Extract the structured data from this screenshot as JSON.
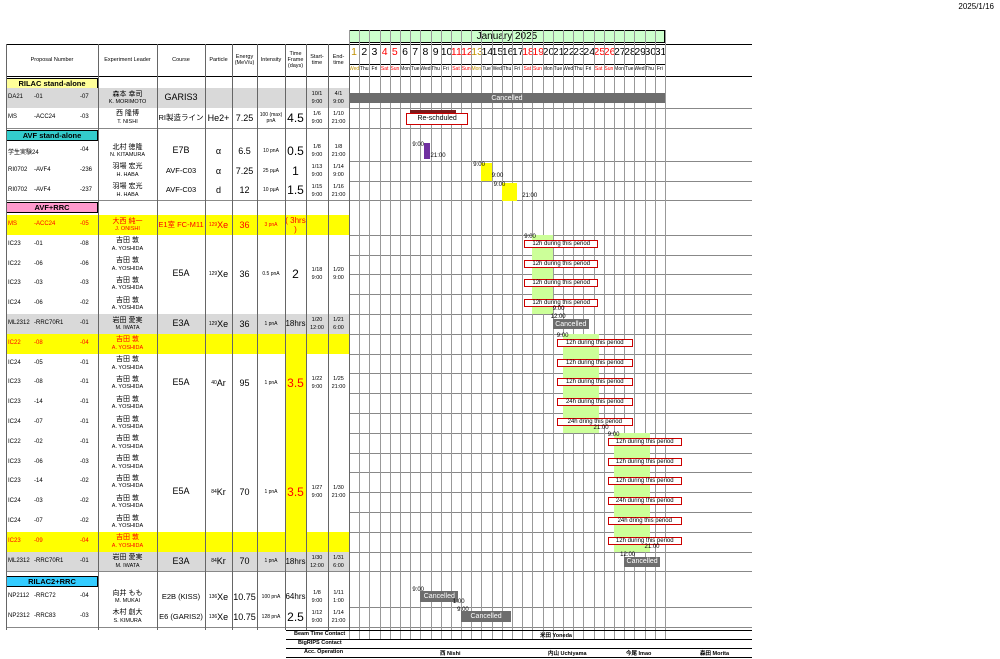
{
  "date_stamp": "2025/1/16",
  "headers": {
    "proposal": "Proposal Number",
    "leader": "Experiment Leader",
    "course": "Course",
    "particle": "Particle",
    "energy": "Energy (MeV/u)",
    "intensity": "Intensity",
    "timeframe": "Time Frame (days)",
    "start": "Start-time",
    "end": "End-time"
  },
  "month_title": "January 2025",
  "days": [
    [
      "1",
      "Wed"
    ],
    [
      "2",
      "Thu"
    ],
    [
      "3",
      "Fri"
    ],
    [
      "4",
      "Sat"
    ],
    [
      "5",
      "Sun"
    ],
    [
      "6",
      "Mon"
    ],
    [
      "7",
      "Tue"
    ],
    [
      "8",
      "Wed"
    ],
    [
      "9",
      "Thu"
    ],
    [
      "10",
      "Fri"
    ],
    [
      "11",
      "Sat"
    ],
    [
      "12",
      "Sun"
    ],
    [
      "13",
      "Mon"
    ],
    [
      "14",
      "Tue"
    ],
    [
      "15",
      "Wed"
    ],
    [
      "16",
      "Thu"
    ],
    [
      "17",
      "Fri"
    ],
    [
      "18",
      "Sat"
    ],
    [
      "19",
      "Sun"
    ],
    [
      "20",
      "Mon"
    ],
    [
      "21",
      "Tue"
    ],
    [
      "22",
      "Wed"
    ],
    [
      "23",
      "Thu"
    ],
    [
      "24",
      "Fri"
    ],
    [
      "25",
      "Sat"
    ],
    [
      "26",
      "Sun"
    ],
    [
      "27",
      "Mon"
    ],
    [
      "28",
      "Tue"
    ],
    [
      "29",
      "Wed"
    ],
    [
      "30",
      "Thu"
    ],
    [
      "31",
      "Fri"
    ]
  ],
  "colors": {
    "rilac": "#ffff99",
    "avf": "#33cccc",
    "avfrrc": "#ff99cc",
    "rilac2": "#33ccff",
    "yellow": "#ffff00",
    "red": "#ff0000",
    "grey": "#d9d9d9",
    "green": "#ccff99",
    "purple": "#7030a0",
    "holiday": "#c09000"
  },
  "sections": {
    "rilac": "RILAC stand-alone",
    "avf": "AVF stand-alone",
    "avfrrc": "AVF+RRC",
    "rilac2": "RILAC2+RRC"
  },
  "rows": [
    {
      "p1": "DA21",
      "p2": "-01",
      "p3": "-07",
      "l1": "森本 幸司",
      "l2": "K. MORIMOTO",
      "course": "GARIS3",
      "start1": "10/1",
      "start2": "9:00",
      "end1": "4/1",
      "end2": "9:00"
    },
    {
      "p1": "MS",
      "p2": "-ACC24",
      "p3": "-03",
      "l1": "西 隆博",
      "l2": "T. NISHI",
      "course": "RI製造ライン",
      "particle": "He2+",
      "energy": "7.25",
      "intensity": "100 (max) pnA",
      "tf": "4.5",
      "start1": "1/6",
      "start2": "9:00",
      "end1": "1/10",
      "end2": "21:00"
    },
    {
      "p1": "学生実験24",
      "p2": "",
      "p3": "-04",
      "l1": "北村 徳隆",
      "l2": "N. KITAMURA",
      "course": "E7B",
      "particle": "α",
      "energy": "6.5",
      "intensity": "10 pnA",
      "tf": "0.5",
      "start1": "1/8",
      "start2": "9:00",
      "end1": "1/8",
      "end2": "21:00"
    },
    {
      "p1": "RI0702",
      "p2": "-AVF4",
      "p3": "-236",
      "l1": "羽場 宏光",
      "l2": "H. HABA",
      "course": "AVF-C03",
      "particle": "α",
      "energy": "7.25",
      "intensity": "25 pμA",
      "tf": "1",
      "start1": "1/13",
      "start2": "9:00",
      "end1": "1/14",
      "end2": "9:00"
    },
    {
      "p1": "RI0702",
      "p2": "-AVF4",
      "p3": "-237",
      "l1": "羽場 宏光",
      "l2": "H. HABA",
      "course": "AVF-C03",
      "particle": "d",
      "energy": "12",
      "intensity": "10 pμA",
      "tf": "1.5",
      "start1": "1/15",
      "start2": "9:00",
      "end1": "1/16",
      "end2": "21:00"
    },
    {
      "p1": "MS",
      "p2": "-ACC24",
      "p3": "-05",
      "l1": "大西 純一",
      "l2": "J. ONISHI",
      "course": "E1室 FC-M11",
      "particle": "129Xe",
      "energy": "36",
      "intensity": "3 pnA",
      "tf": "( 3hrs )"
    },
    {
      "p1": "IC23",
      "p2": "-01",
      "p3": "-08",
      "l1": "吉田 敦",
      "l2": "A. YOSHIDA"
    },
    {
      "p1": "IC22",
      "p2": "-06",
      "p3": "-06",
      "l1": "吉田 敦",
      "l2": "A. YOSHIDA",
      "course": "E5A",
      "particle": "129Xe",
      "energy": "36",
      "intensity": "0.5 pnA",
      "tf": "2",
      "start1": "1/18",
      "start2": "9:00",
      "end1": "1/20",
      "end2": "9:00"
    },
    {
      "p1": "IC23",
      "p2": "-03",
      "p3": "-03",
      "l1": "吉田 敦",
      "l2": "A. YOSHIDA"
    },
    {
      "p1": "IC24",
      "p2": "-06",
      "p3": "-02",
      "l1": "吉田 敦",
      "l2": "A. YOSHIDA"
    },
    {
      "p1": "ML2312",
      "p2": "-RRC70R1",
      "p3": "-01",
      "l1": "岩田 愛実",
      "l2": "M. IWATA",
      "course": "E3A",
      "particle": "129Xe",
      "energy": "36",
      "intensity": "1 pnA",
      "tf": "18hrs",
      "start1": "1/20",
      "start2": "12:00",
      "end1": "1/21",
      "end2": "6:00"
    },
    {
      "p1": "IC22",
      "p2": "-08",
      "p3": "-04",
      "l1": "吉田 敦",
      "l2": "A. YOSHIDA"
    },
    {
      "p1": "IC24",
      "p2": "-05",
      "p3": "-01",
      "l1": "吉田 敦",
      "l2": "A. YOSHIDA"
    },
    {
      "p1": "IC23",
      "p2": "-08",
      "p3": "-01",
      "l1": "吉田 敦",
      "l2": "A. YOSHIDA",
      "course": "E5A",
      "particle": "40Ar",
      "energy": "95",
      "intensity": "1 pnA",
      "tf": "3.5",
      "start1": "1/22",
      "start2": "9:00",
      "end1": "1/25",
      "end2": "21:00"
    },
    {
      "p1": "IC23",
      "p2": "-14",
      "p3": "-01",
      "l1": "吉田 敦",
      "l2": "A. YOSHIDA"
    },
    {
      "p1": "IC24",
      "p2": "-07",
      "p3": "-01",
      "l1": "吉田 敦",
      "l2": "A. YOSHIDA"
    },
    {
      "p1": "IC22",
      "p2": "-02",
      "p3": "-01",
      "l1": "吉田 敦",
      "l2": "A. YOSHIDA"
    },
    {
      "p1": "IC23",
      "p2": "-06",
      "p3": "-03",
      "l1": "吉田 敦",
      "l2": "A. YOSHIDA"
    },
    {
      "p1": "IC23",
      "p2": "-14",
      "p3": "-02",
      "l1": "吉田 敦",
      "l2": "A. YOSHIDA",
      "course": "E5A",
      "particle": "84Kr",
      "energy": "70",
      "intensity": "1 pnA",
      "tf": "3.5",
      "start1": "1/27",
      "start2": "9:00",
      "end1": "1/30",
      "end2": "21:00"
    },
    {
      "p1": "IC24",
      "p2": "-03",
      "p3": "-02",
      "l1": "吉田 敦",
      "l2": "A. YOSHIDA"
    },
    {
      "p1": "IC24",
      "p2": "-07",
      "p3": "-02",
      "l1": "吉田 敦",
      "l2": "A. YOSHIDA"
    },
    {
      "p1": "IC23",
      "p2": "-09",
      "p3": "-04",
      "l1": "吉田 敦",
      "l2": "A. YOSHIDA"
    },
    {
      "p1": "ML2312",
      "p2": "-RRC70R1",
      "p3": "-01",
      "l1": "岩田 愛実",
      "l2": "M. IWATA",
      "course": "E3A",
      "particle": "84Kr",
      "energy": "70",
      "intensity": "1 pnA",
      "tf": "18hrs",
      "start1": "1/30",
      "start2": "12:00",
      "end1": "1/31",
      "end2": "6:00"
    },
    {
      "p1": "NP2112",
      "p2": "-RRC72",
      "p3": "-04",
      "l1": "向井 もも",
      "l2": "M. MUKAI",
      "course": "E2B (KISS)",
      "particle": "136Xe",
      "energy": "10.75",
      "intensity": "100 pnA",
      "tf": "64hrs",
      "start1": "1/8",
      "start2": "9:00",
      "end1": "1/11",
      "end2": "1:00"
    },
    {
      "p1": "NP2312",
      "p2": "-RRC83",
      "p3": "-03",
      "l1": "木村 創大",
      "l2": "S. KIMURA",
      "course": "E6 (GARIS2)",
      "particle": "136Xe",
      "energy": "10.75",
      "intensity": "128 pnA",
      "tf": "2.5",
      "start1": "1/12",
      "start2": "9:00",
      "end1": "1/14",
      "end2": "21:00"
    }
  ],
  "chart": {
    "cancelled": "Cancelled",
    "reschedule": "Re-schduled",
    "t900": "9:00",
    "t2100": "21:00",
    "t1200": "12:00",
    "t600": "6:00",
    "t100": "1:00",
    "p12": "12h during this period",
    "p24": "24h during this period",
    "p24b": "24h dring this period",
    "p12b": "12h  during this period"
  },
  "footer": {
    "bt": "Beam Time Contact",
    "bt_name": "米田 Yoneda",
    "bigrips": "BigRIPS Contact",
    "acc": "Acc. Operation",
    "ops": [
      "西 Nishi",
      "内山 Uchiyama",
      "今尾 Imao",
      "森田 Morita"
    ]
  }
}
